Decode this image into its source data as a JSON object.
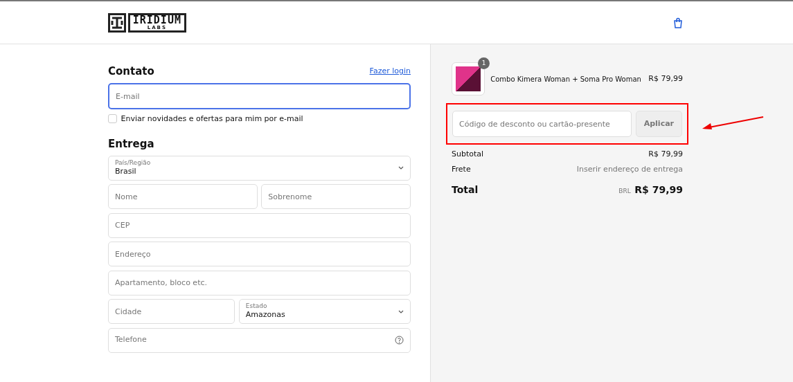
{
  "header": {
    "logo_word": "IRIDIUM",
    "logo_sub": "LABS"
  },
  "contact": {
    "title": "Contato",
    "login_link": "Fazer login",
    "email": {
      "placeholder": "E-mail",
      "focused": true
    },
    "newsletter": {
      "label": "Enviar novidades e ofertas para mim por e-mail",
      "checked": false
    }
  },
  "delivery": {
    "title": "Entrega",
    "rows": [
      [
        {
          "kind": "select",
          "label": "País/Região",
          "value": "Brasil"
        }
      ],
      [
        {
          "kind": "input",
          "placeholder": "Nome"
        },
        {
          "kind": "input",
          "placeholder": "Sobrenome"
        }
      ],
      [
        {
          "kind": "input",
          "placeholder": "CEP"
        }
      ],
      [
        {
          "kind": "input",
          "placeholder": "Endereço"
        }
      ],
      [
        {
          "kind": "input",
          "placeholder": "Apartamento, bloco etc."
        }
      ],
      [
        {
          "kind": "input",
          "placeholder": "Cidade"
        },
        {
          "kind": "select",
          "label": "Estado",
          "value": "Amazonas"
        }
      ],
      [
        {
          "kind": "help",
          "placeholder": "Telefone"
        }
      ]
    ]
  },
  "summary": {
    "items": [
      {
        "name": "Combo Kimera Woman + Soma Pro Woman",
        "price": "R$ 79,99",
        "quantity": "1"
      }
    ],
    "discount": {
      "placeholder": "Código de desconto ou cartão-presente",
      "button": "Aplicar",
      "highlighted": true
    },
    "lines": [
      {
        "label": "Subtotal",
        "value": "R$ 79,99",
        "muted": false
      },
      {
        "label": "Frete",
        "value": "Inserir endereço de entrega",
        "muted": true
      }
    ],
    "total": {
      "label": "Total",
      "currency": "BRL",
      "value": "R$ 79,99"
    }
  }
}
